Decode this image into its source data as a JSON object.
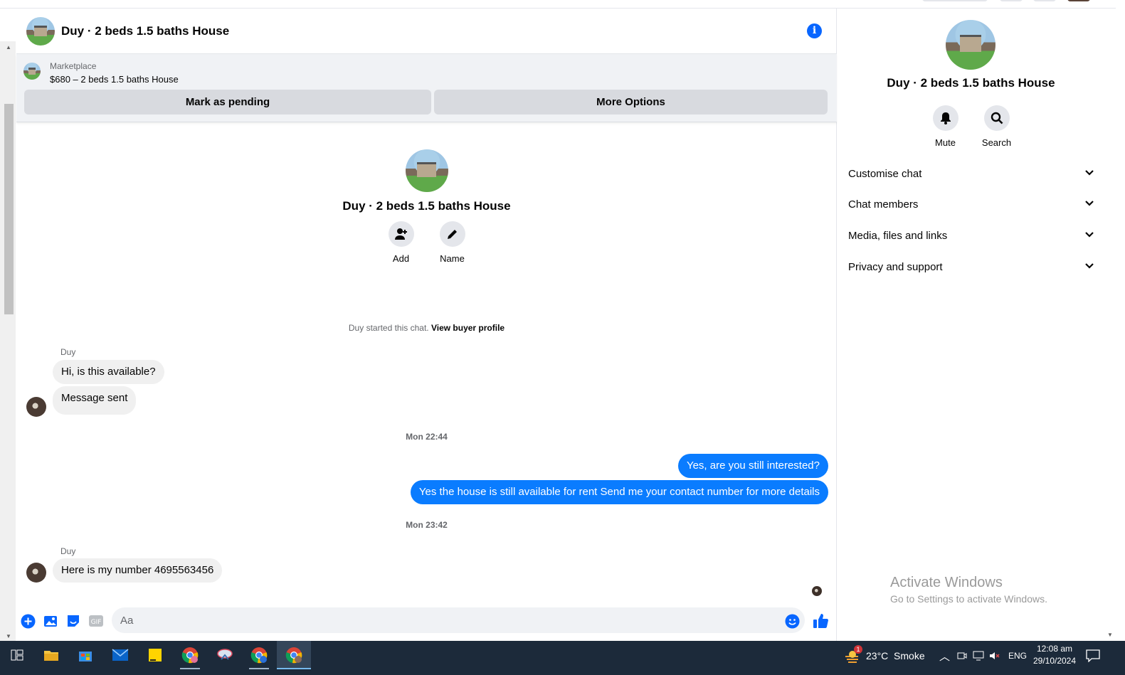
{
  "conversation": {
    "title": "Duy · 2 beds 1.5 baths House"
  },
  "marketplace": {
    "label": "Marketplace",
    "item": "$680 – 2 beds 1.5 baths House",
    "mark_pending": "Mark as pending",
    "more_options": "More Options"
  },
  "intro": {
    "title": "Duy · 2 beds 1.5 baths House",
    "add_label": "Add",
    "name_label": "Name",
    "started_text": "Duy started this chat.",
    "view_buyer": "View buyer profile"
  },
  "messages": [
    {
      "sender": "Duy",
      "text": "Hi, is this available?"
    },
    {
      "text": "Message sent"
    },
    {
      "timestamp": "Mon 22:44"
    },
    {
      "text": "Yes, are you still interested?"
    },
    {
      "text": "Yes the house is still available for rent Send me your contact number for more details"
    },
    {
      "timestamp": "Mon 23:42"
    },
    {
      "sender": "Duy",
      "text": "Here is my number 4695563456"
    }
  ],
  "composer": {
    "placeholder": "Aa",
    "gif_label": "GIF"
  },
  "info_panel": {
    "title": "Duy · 2 beds 1.5 baths House",
    "mute_label": "Mute",
    "search_label": "Search",
    "sections": [
      "Customise chat",
      "Chat members",
      "Media, files and links",
      "Privacy and support"
    ]
  },
  "watermark": {
    "line1": "Activate Windows",
    "line2": "Go to Settings to activate Windows."
  },
  "taskbar": {
    "weather": "23°C  Smoke",
    "weather_badge": "1",
    "language": "ENG",
    "time": "12:08 am",
    "date": "29/10/2024"
  },
  "colors": {
    "accent": "#0866ff",
    "outgoing_bubble": "#0a7cff",
    "incoming_bubble": "#f0f0f0",
    "taskbar": "#1c2a3a"
  }
}
